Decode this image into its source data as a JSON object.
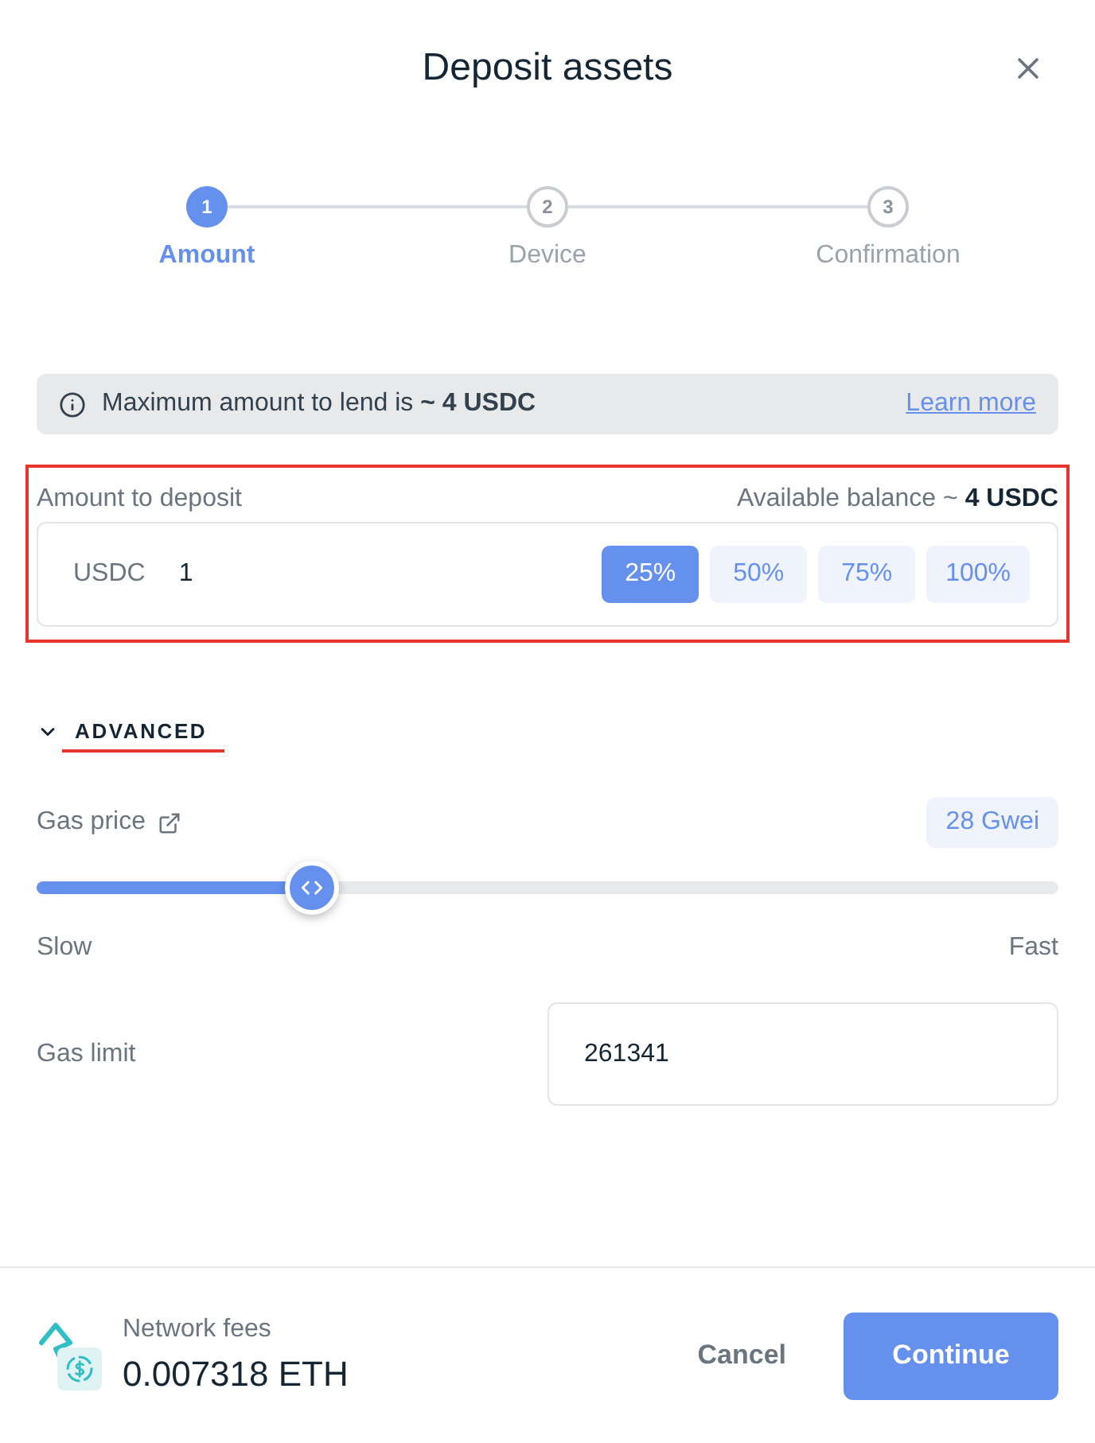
{
  "dialog": {
    "title": "Deposit assets"
  },
  "steps": [
    {
      "number": "1",
      "label": "Amount",
      "selected": true
    },
    {
      "number": "2",
      "label": "Device",
      "selected": false
    },
    {
      "number": "3",
      "label": "Confirmation",
      "selected": false
    }
  ],
  "notice": {
    "text": "Maximum amount to lend is **~ 4 USDC**",
    "link": "Learn more"
  },
  "amount": {
    "highlighted": true,
    "label": "Amount to deposit",
    "balance": "Available balance ~ **4 USDC**",
    "currency": "USDC",
    "value": "1",
    "presets": [
      {
        "label": "25%",
        "selected": true
      },
      {
        "label": "50%",
        "selected": false
      },
      {
        "label": "75%",
        "selected": false
      },
      {
        "label": "100%",
        "selected": false
      }
    ]
  },
  "advanced": {
    "label": "ADVANCED",
    "expanded": true,
    "highlighted": true
  },
  "gas_price": {
    "label": "Gas price",
    "reading": "28 Gwei",
    "level": 0.27,
    "min_label": "Slow",
    "max_label": "Fast"
  },
  "gas_limit": {
    "label": "Gas limit",
    "value": "261341"
  },
  "footer": {
    "fees_label": "Network fees",
    "fees": "0.007318 ETH",
    "buttons": [
      {
        "label": "Cancel",
        "kind": "secondary"
      },
      {
        "label": "Continue",
        "kind": "primary"
      }
    ]
  }
}
